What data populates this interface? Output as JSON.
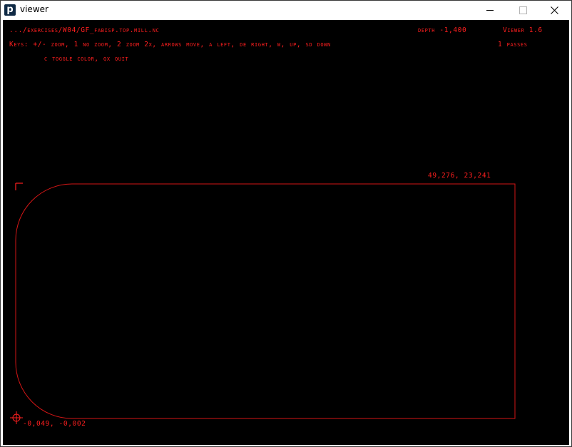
{
  "window": {
    "title": "viewer",
    "app_icon_letter": "p",
    "controls": {
      "minimize": "minimize",
      "maximize": "maximize",
      "close": "close"
    }
  },
  "viewer": {
    "file_path": ".../exercises/W04/GF_fabisp.top.mill.nc",
    "depth": "depth -1,400",
    "version": "Viewer 1.6",
    "keys_line1": "Keys: +/- zoom, 1 no zoom, 2 zoom 2x, arrows move, a left, de right, w, up, sd down",
    "keys_line2": "c toggle color, qx quit",
    "passes": "1 passes",
    "max_coord": "49,276,  23,241",
    "min_coord": "-0,049, -0,002"
  },
  "colors": {
    "background": "#000000",
    "foreground": "#ff1f1f",
    "toolpath": "#d41616"
  },
  "icons": {
    "origin": "crosshair-icon",
    "corner": "corner-marker-icon"
  }
}
